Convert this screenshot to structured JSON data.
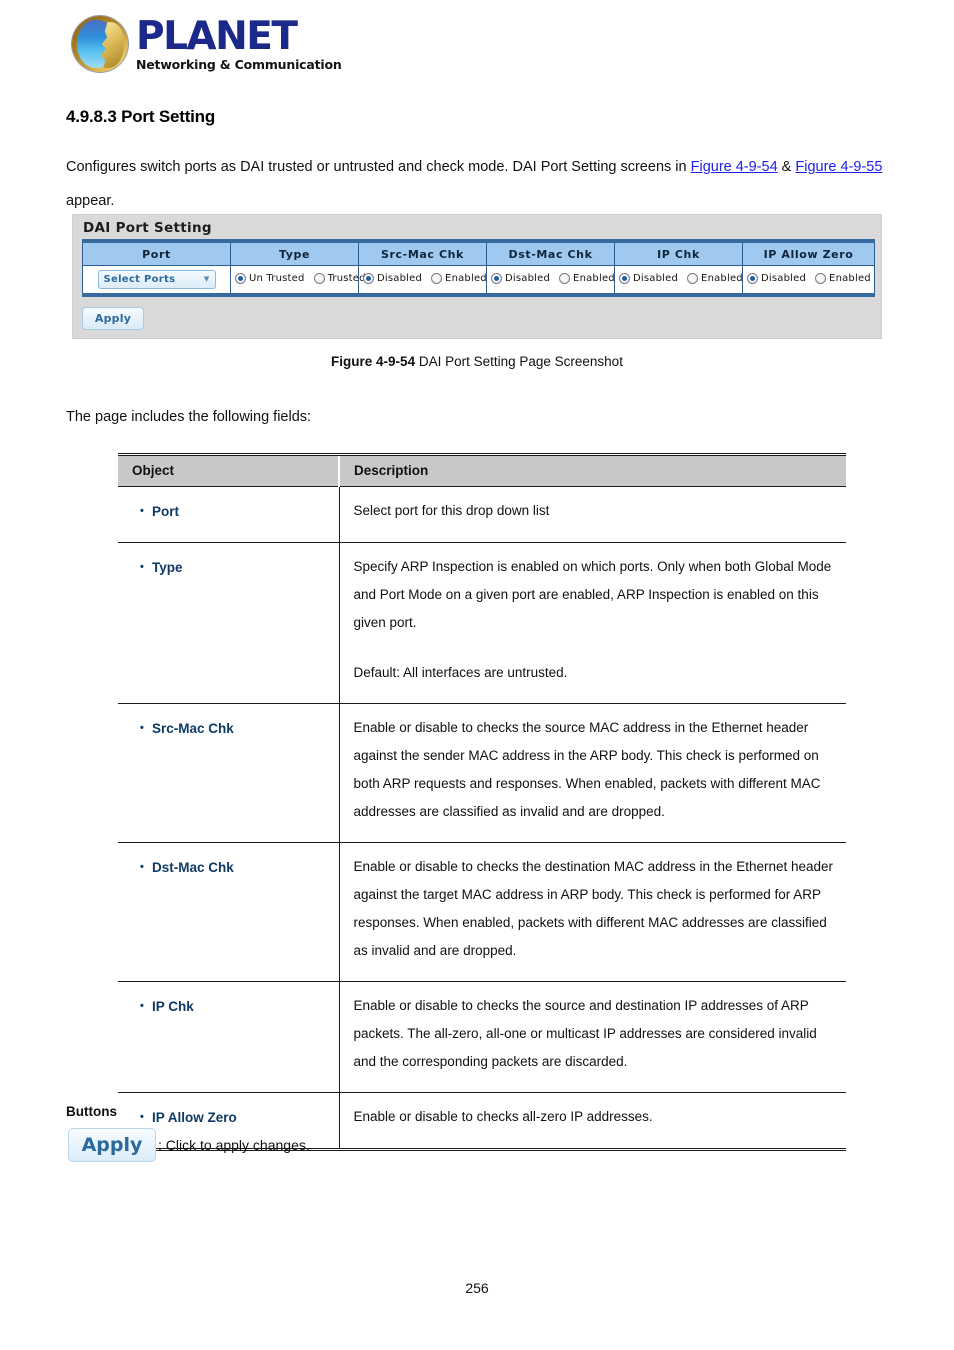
{
  "logo": {
    "word": "PLANET",
    "tagline": "Networking & Communication",
    "icon": "planet-globe-icon"
  },
  "section": {
    "title": "4.9.8.3 Port Setting",
    "intro_before": "Configures switch ports as DAI trusted or untrusted and check mode. DAI Port Setting screens in ",
    "link1": "Figure 4-9-54",
    "intro_mid": " & ",
    "link2": "Figure 4-9-55",
    "intro_after": " appear.",
    "link_color": "#2020ee"
  },
  "screenshot": {
    "panel_title": "DAI Port Setting",
    "headers": [
      "Port",
      "Type",
      "Src-Mac Chk",
      "Dst-Mac Chk",
      "IP Chk",
      "IP Allow Zero"
    ],
    "port_select": {
      "value": "Select Ports",
      "caret": "▼"
    },
    "type_options": [
      {
        "label": "Un Trusted",
        "selected": true
      },
      {
        "label": "Trusted",
        "selected": false
      }
    ],
    "src_mac_options": [
      {
        "label": "Disabled",
        "selected": true
      },
      {
        "label": "Enabled",
        "selected": false
      }
    ],
    "dst_mac_options": [
      {
        "label": "Disabled",
        "selected": true
      },
      {
        "label": "Enabled",
        "selected": false
      }
    ],
    "ip_chk_options": [
      {
        "label": "Disabled",
        "selected": true
      },
      {
        "label": "Enabled",
        "selected": false
      }
    ],
    "ip_allow_zero_options": [
      {
        "label": "Disabled",
        "selected": true
      },
      {
        "label": "Enabled",
        "selected": false
      }
    ],
    "apply_label": "Apply",
    "header_bg": "#9fc9ef",
    "border_color": "#36699e",
    "panel_bg": "#d9d9d9"
  },
  "figure": {
    "number": "Figure 4-9-54",
    "caption": " DAI Port Setting Page Screenshot"
  },
  "lead_in": "The page includes the following fields:",
  "fields_table": {
    "headers": {
      "object": "Object",
      "description": "Description"
    },
    "rows": [
      {
        "object": "Port",
        "paragraphs": [
          "Select port for this drop down list"
        ]
      },
      {
        "object": "Type",
        "paragraphs": [
          "Specify ARP Inspection is enabled on which ports. Only when both Global Mode and Port Mode on a given port are enabled, ARP Inspection is enabled on this given port.",
          "Default: All interfaces are untrusted."
        ]
      },
      {
        "object": "Src-Mac Chk",
        "paragraphs": [
          "Enable or disable to checks the source MAC address in the Ethernet header against the sender MAC address in the ARP body. This check is performed on both ARP requests and responses. When enabled, packets with different MAC addresses are classified as invalid and are dropped."
        ]
      },
      {
        "object": "Dst-Mac Chk",
        "paragraphs": [
          "Enable or disable to checks the destination MAC address in the Ethernet header against the target MAC address in ARP body. This check is performed for ARP responses. When enabled, packets with different MAC addresses are classified as invalid and are dropped."
        ]
      },
      {
        "object": "IP Chk",
        "paragraphs": [
          "Enable or disable to checks the source and destination IP addresses of ARP packets. The all-zero, all-one or multicast IP addresses are considered invalid and the corresponding packets are discarded."
        ]
      },
      {
        "object": "IP Allow Zero",
        "paragraphs": [
          "Enable or disable to checks all-zero IP addresses."
        ]
      }
    ],
    "bullet_glyph": "•",
    "object_color": "#0f3a63",
    "header_bg": "#c8c8c8"
  },
  "buttons_section": {
    "heading": "Buttons",
    "apply_label": "Apply",
    "apply_note": ": Click to apply changes."
  },
  "page_number": "256"
}
